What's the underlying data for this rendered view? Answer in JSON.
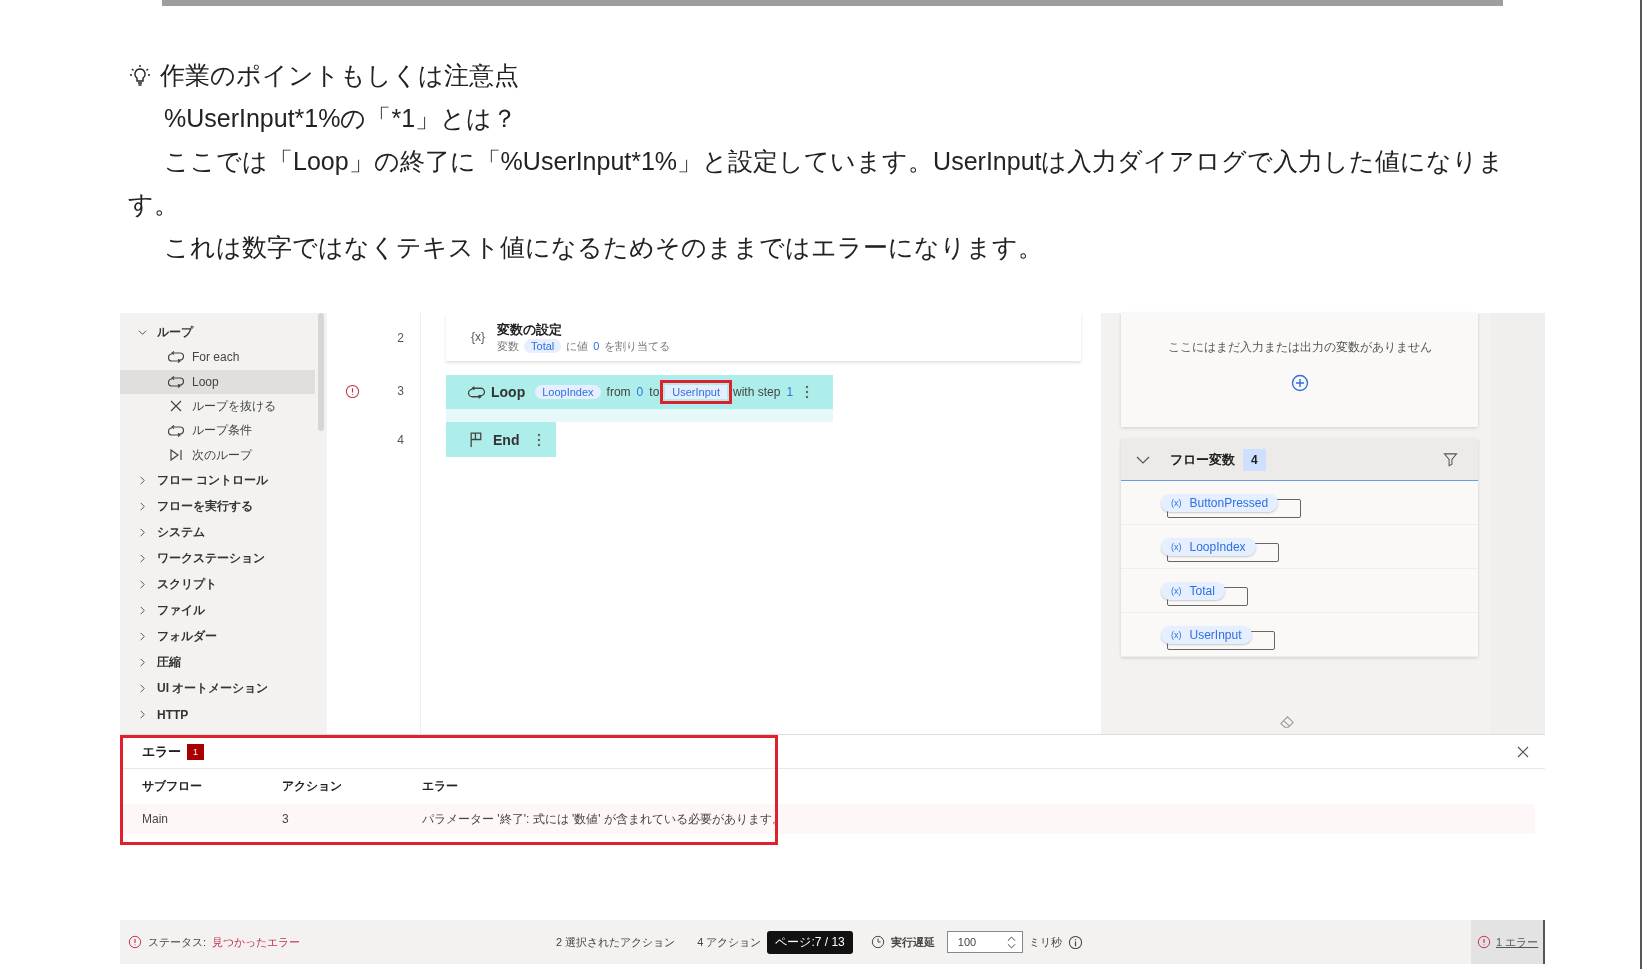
{
  "document": {
    "heading": "作業のポイントもしくは注意点",
    "paragraphs": [
      "%UserInput*1%の「*1」とは？",
      "ここでは「Loop」の終了に「%UserInput*1%」と設定しています。UserInputは入力ダイアログで入力した値になります。",
      "これは数字ではなくテキスト値になるためそのままではエラーになります。"
    ]
  },
  "screenshot": {
    "actions_panel": {
      "items": [
        {
          "label": "ループ",
          "expanded": true,
          "children": [
            {
              "label": "For each",
              "kind": "loop",
              "selected": false
            },
            {
              "label": "Loop",
              "kind": "loop",
              "selected": true
            },
            {
              "label": "ループを抜ける",
              "kind": "exit",
              "selected": false
            },
            {
              "label": "ループ条件",
              "kind": "loop",
              "selected": false
            },
            {
              "label": "次のループ",
              "kind": "next",
              "selected": false
            }
          ]
        },
        {
          "label": "フロー コントロール",
          "expanded": false
        },
        {
          "label": "フローを実行する",
          "expanded": false
        },
        {
          "label": "システム",
          "expanded": false
        },
        {
          "label": "ワークステーション",
          "expanded": false
        },
        {
          "label": "スクリプト",
          "expanded": false
        },
        {
          "label": "ファイル",
          "expanded": false
        },
        {
          "label": "フォルダー",
          "expanded": false
        },
        {
          "label": "圧縮",
          "expanded": false
        },
        {
          "label": "UI オートメーション",
          "expanded": false
        },
        {
          "label": "HTTP",
          "expanded": false
        }
      ]
    },
    "flow": {
      "steps": [
        {
          "number": "2",
          "kind": "set_variable",
          "error": false,
          "symbol": "{x}",
          "title": "変数の設定",
          "tokens": [
            {
              "text": "変数",
              "kind": "text"
            },
            {
              "text": "Total",
              "kind": "var"
            },
            {
              "text": "に値",
              "kind": "text"
            },
            {
              "text": "0",
              "kind": "num"
            },
            {
              "text": "を割り当てる",
              "kind": "text"
            }
          ]
        },
        {
          "number": "3",
          "kind": "loop",
          "error": true,
          "title": "Loop",
          "tokens": [
            {
              "text": "LoopIndex",
              "kind": "var"
            },
            {
              "text": "from",
              "kind": "text"
            },
            {
              "text": "0",
              "kind": "num"
            },
            {
              "text": "to",
              "kind": "text"
            },
            {
              "text": "UserInput",
              "kind": "var",
              "marked": true
            },
            {
              "text": "with step",
              "kind": "text"
            },
            {
              "text": "1",
              "kind": "num"
            }
          ]
        },
        {
          "number": "4",
          "kind": "end",
          "error": false,
          "title": "End"
        }
      ]
    },
    "variables_panel": {
      "io_message": "ここにはまだ入力または出力の変数がありません",
      "flow_variables": {
        "title": "フロー変数",
        "count": "4",
        "expanded": true,
        "items": [
          {
            "symbol": "(x)",
            "name": "ButtonPressed"
          },
          {
            "symbol": "(x)",
            "name": "LoopIndex"
          },
          {
            "symbol": "(x)",
            "name": "Total"
          },
          {
            "symbol": "(x)",
            "name": "UserInput"
          }
        ]
      }
    },
    "error_panel": {
      "title": "エラー",
      "count": "1",
      "marked": true,
      "columns": [
        "サブフロー",
        "アクション",
        "エラー"
      ],
      "rows": [
        [
          "Main",
          "3",
          "パラメーター '終了': 式には '数値' が含まれている必要があります。"
        ]
      ]
    },
    "status_bar": {
      "status_label": "ステータス:",
      "status_value": "見つかったエラー",
      "selected_actions": "2 選択されたアクション",
      "actions": "4 アクション",
      "delay_label": "実行遅延",
      "delay_value": "100",
      "delay_unit": "ミリ秒",
      "errors_link": "1 エラー"
    }
  },
  "page_indicator": "ページ:7 / 13"
}
